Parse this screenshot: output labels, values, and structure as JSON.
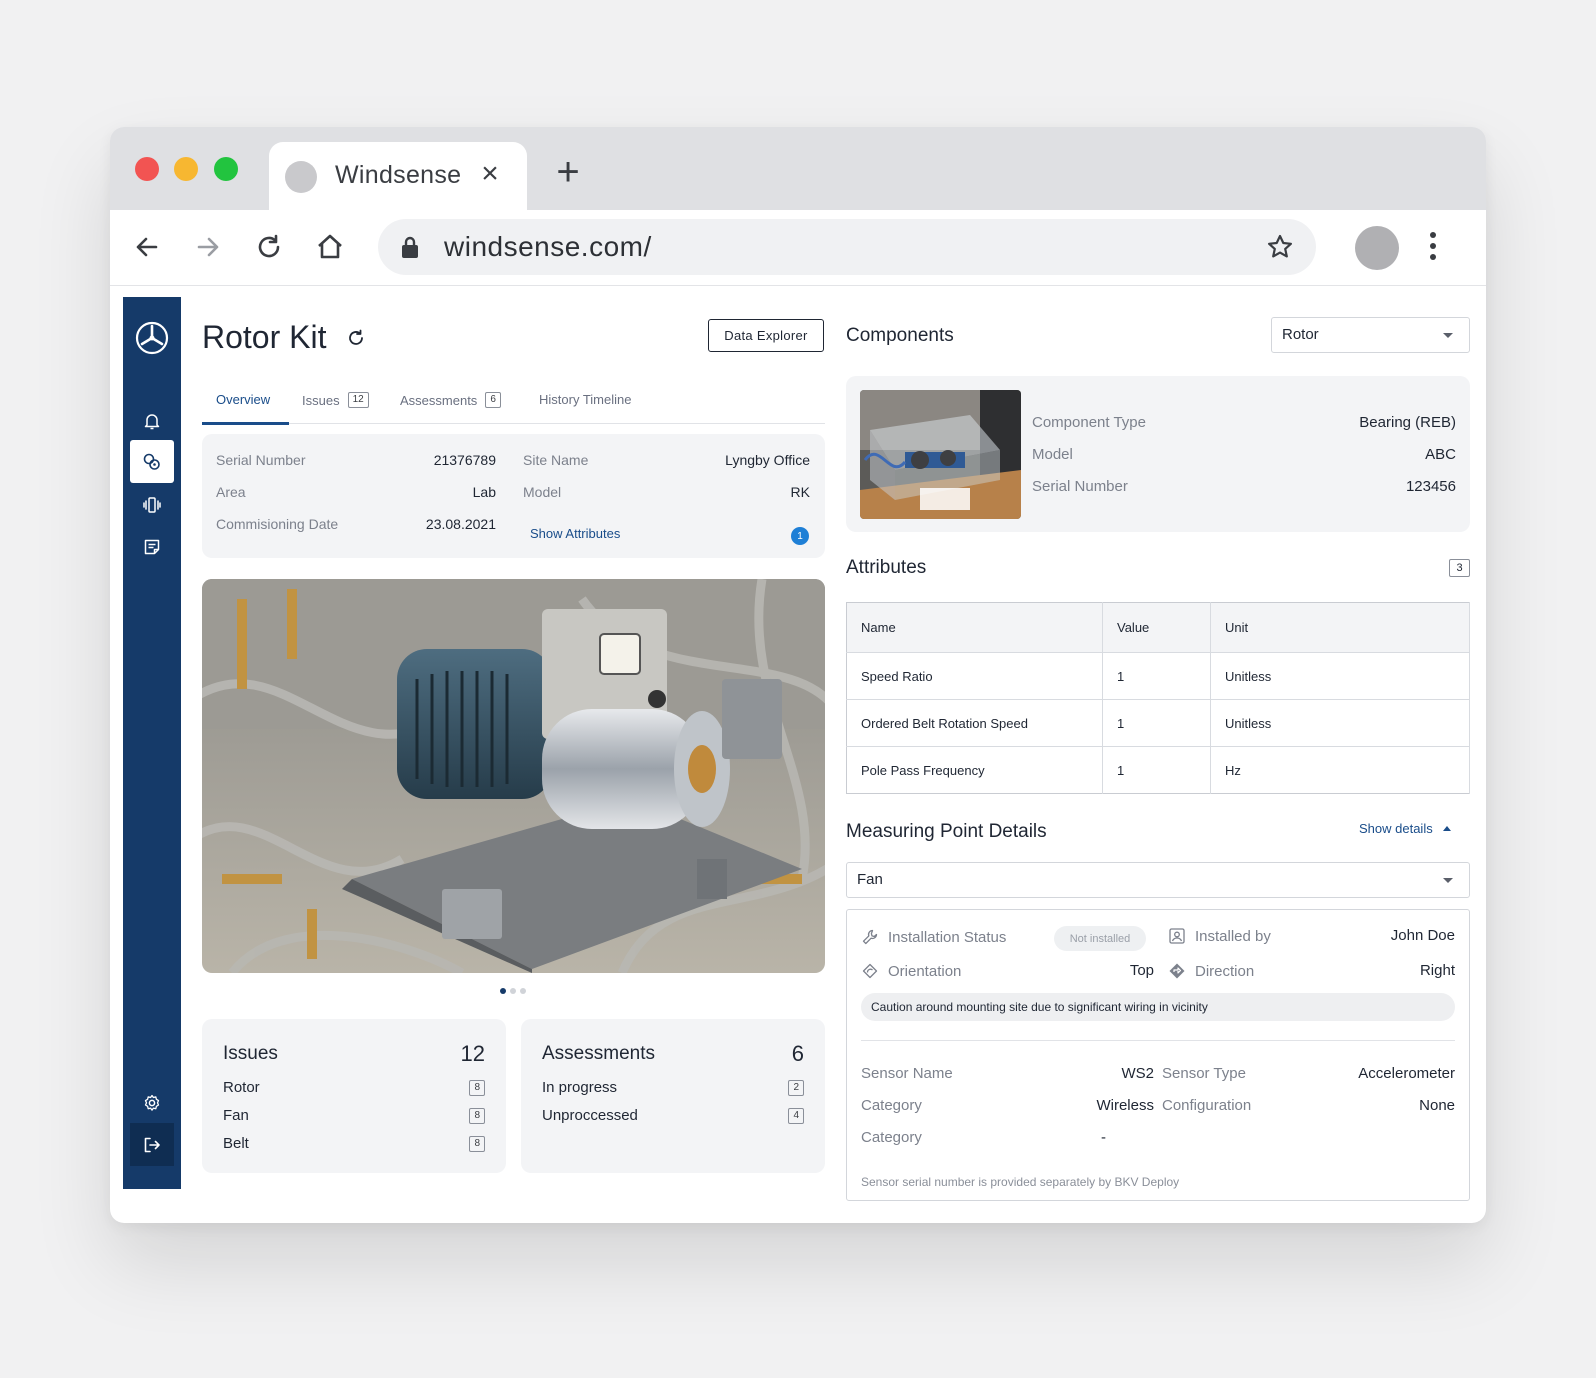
{
  "browser": {
    "tab_title": "Windsense",
    "url": "windsense.com/"
  },
  "page": {
    "title": "Rotor Kit",
    "data_explorer_label": "Data Explorer",
    "tabs": [
      {
        "label": "Overview",
        "count": ""
      },
      {
        "label": "Issues",
        "count": "12"
      },
      {
        "label": "Assessments",
        "count": "6"
      },
      {
        "label": "History Timeline",
        "count": ""
      }
    ],
    "info": {
      "serial_number_label": "Serial Number",
      "serial_number": "21376789",
      "area_label": "Area",
      "area": "Lab",
      "commissioning_label": "Commisioning Date",
      "commissioning": "23.08.2021",
      "site_name_label": "Site Name",
      "site_name": "Lyngby Office",
      "model_label": "Model",
      "model": "RK",
      "show_attributes": "Show Attributes",
      "attributes_badge": "1"
    },
    "issues": {
      "title": "Issues",
      "total": "12",
      "rows": [
        {
          "label": "Rotor",
          "count": "8"
        },
        {
          "label": "Fan",
          "count": "8"
        },
        {
          "label": "Belt",
          "count": "8"
        }
      ]
    },
    "assessments": {
      "title": "Assessments",
      "total": "6",
      "rows": [
        {
          "label": "In progress",
          "count": "2"
        },
        {
          "label": "Unproccessed",
          "count": "4"
        }
      ]
    }
  },
  "components": {
    "title": "Components",
    "selected": "Rotor",
    "type_label": "Component Type",
    "type": "Bearing (REB)",
    "model_label": "Model",
    "model": "ABC",
    "serial_label": "Serial Number",
    "serial": "123456"
  },
  "attributes": {
    "title": "Attributes",
    "count": "3",
    "headers": [
      "Name",
      "Value",
      "Unit"
    ],
    "rows": [
      [
        "Speed Ratio",
        "1",
        "Unitless"
      ],
      [
        "Ordered Belt Rotation Speed",
        "1",
        "Unitless"
      ],
      [
        "Pole Pass Frequency",
        "1",
        "Hz"
      ]
    ]
  },
  "measuring_point": {
    "title": "Measuring Point Details",
    "show_details": "Show details",
    "selected": "Fan",
    "installation_status_label": "Installation Status",
    "installation_status": "Not installed",
    "installed_by_label": "Installed by",
    "installed_by": "John Doe",
    "orientation_label": "Orientation",
    "orientation": "Top",
    "direction_label": "Direction",
    "direction": "Right",
    "caution": "Caution around mounting site due to significant wiring in vicinity",
    "sensor_name_label": "Sensor Name",
    "sensor_name": "WS2",
    "sensor_type_label": "Sensor Type",
    "sensor_type": "Accelerometer",
    "category_label": "Category",
    "category": "Wireless",
    "configuration_label": "Configuration",
    "configuration": "None",
    "category2_label": "Category",
    "category2": "-",
    "note": "Sensor serial number is provided separately by BKV Deploy"
  },
  "colors": {
    "sidebar": "#153a69",
    "accent": "#1a4d8a",
    "badge_blue": "#1e7fd6"
  },
  "icons": [
    "bell-icon",
    "gauge-icon",
    "vibration-icon",
    "notes-icon",
    "settings-icon",
    "logout-icon",
    "refresh-icon",
    "wrench-icon",
    "user-icon",
    "rotate-icon",
    "direction-icon"
  ]
}
